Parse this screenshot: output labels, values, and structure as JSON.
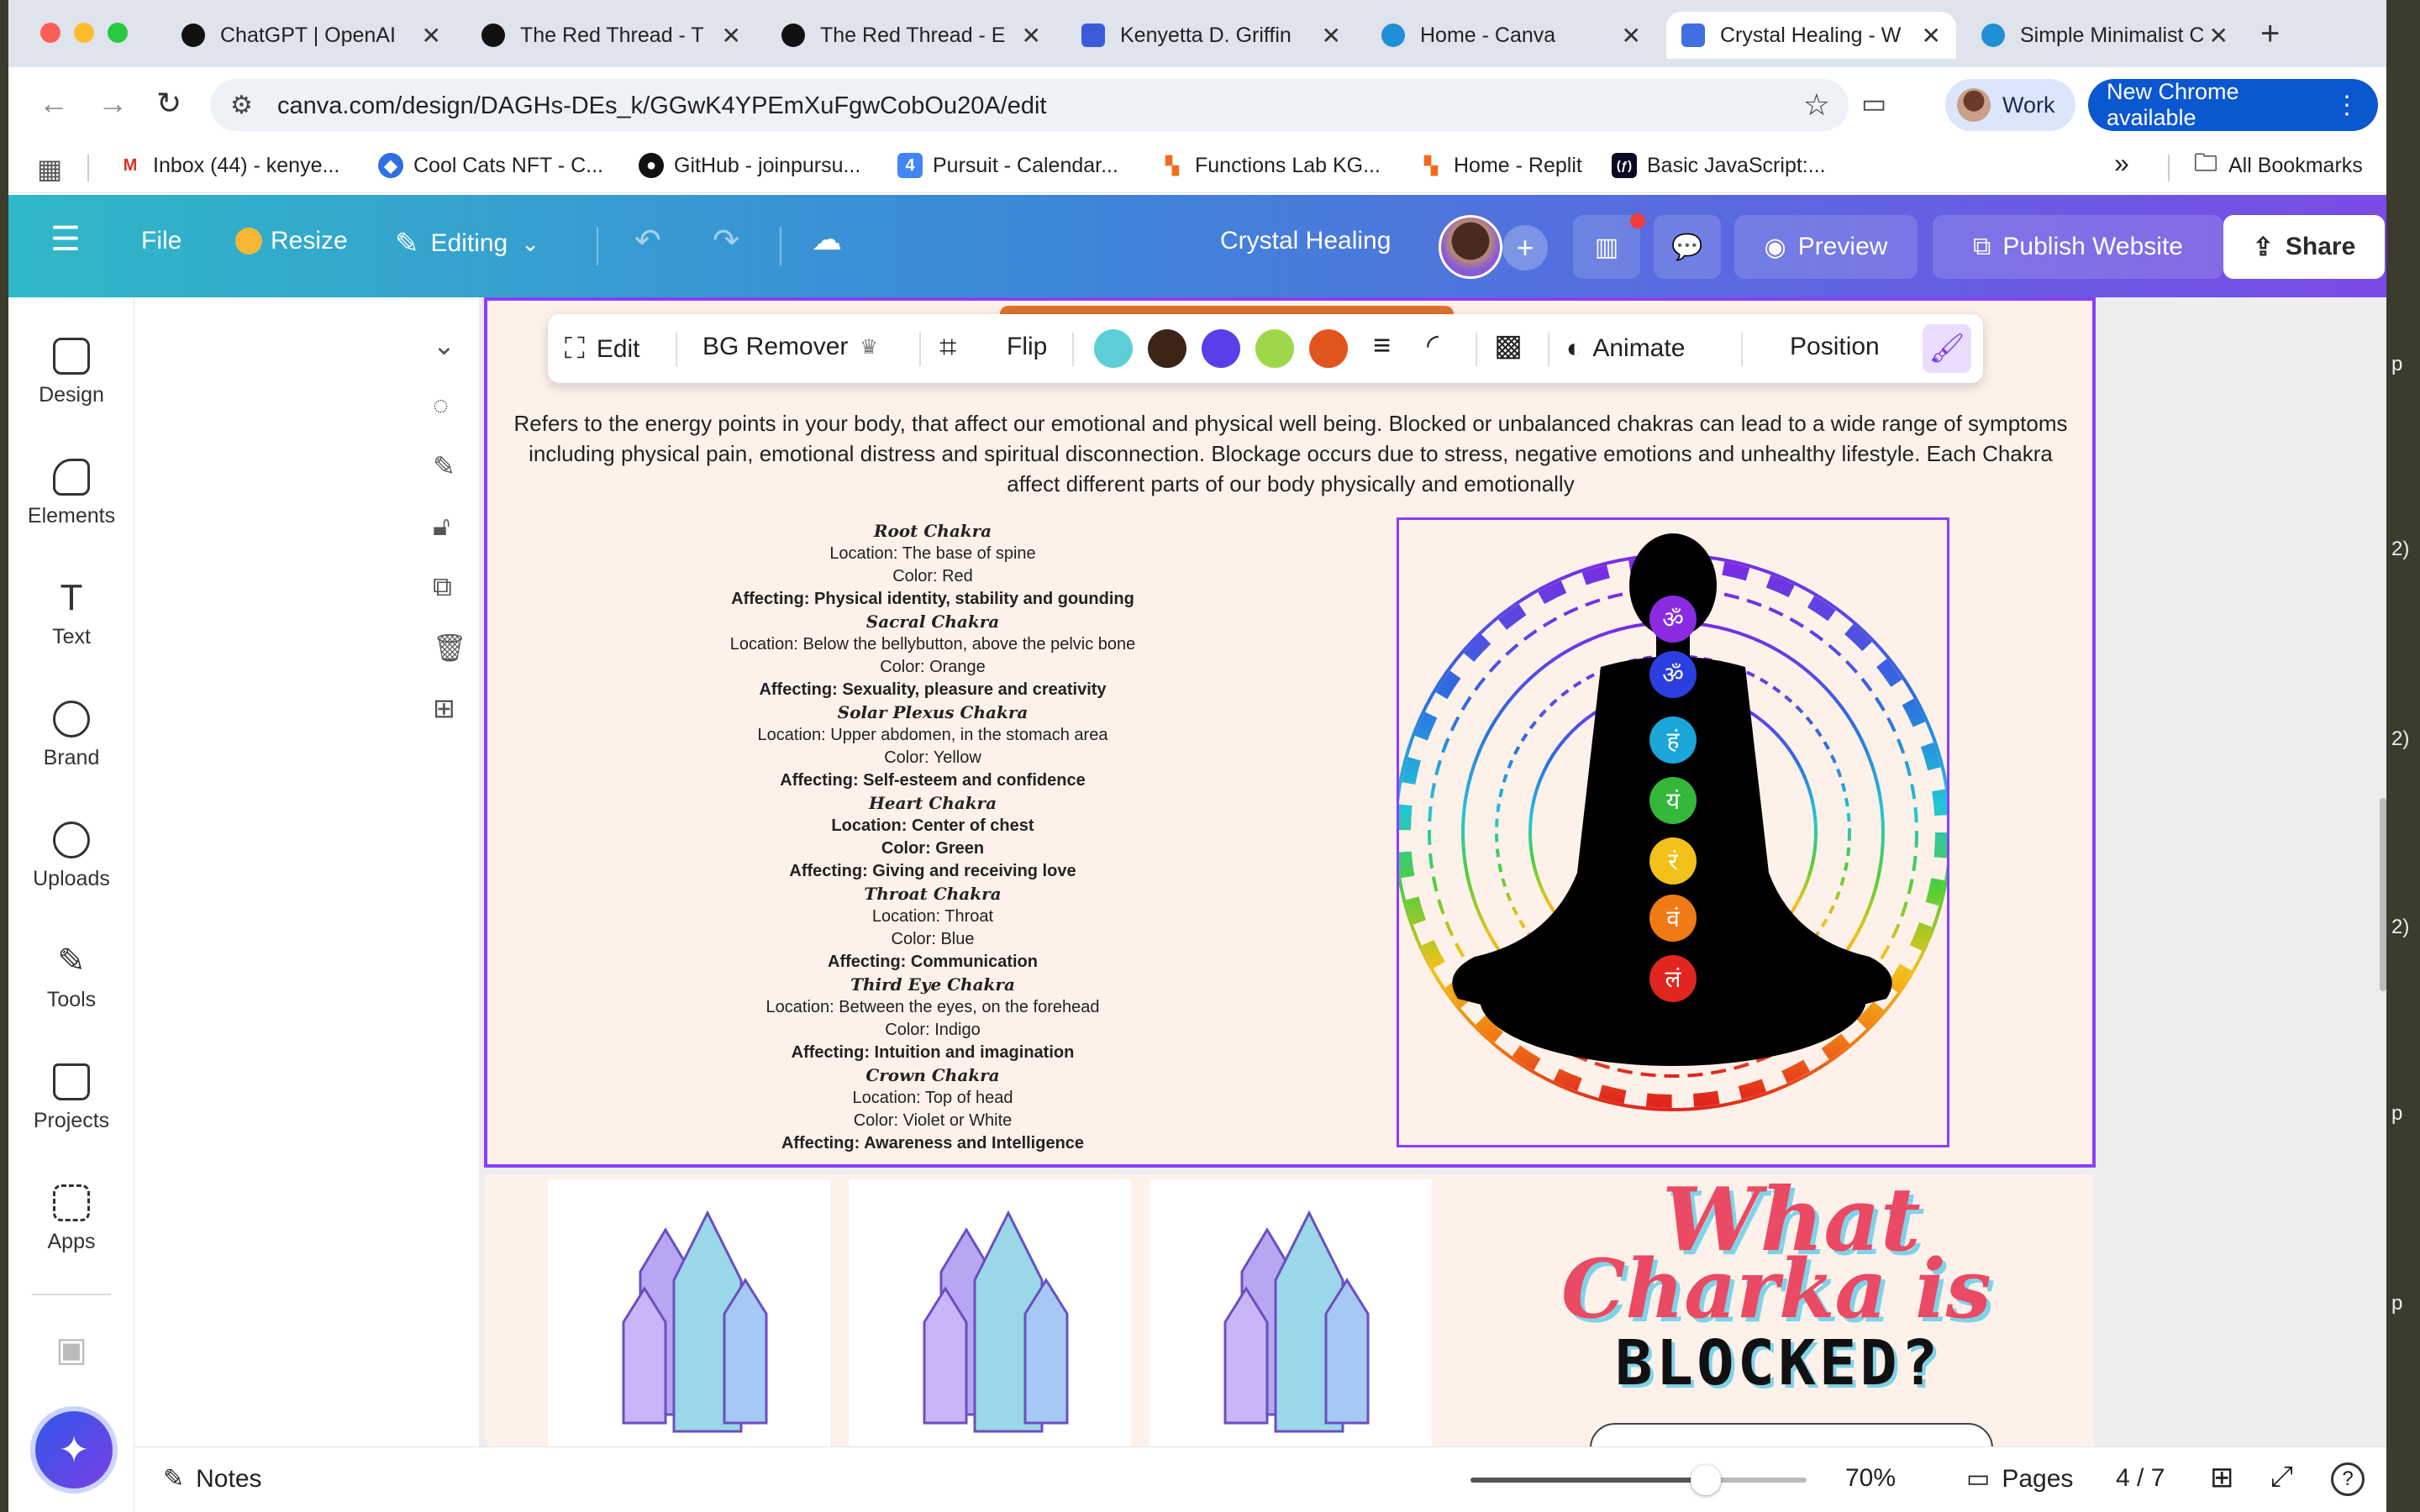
{
  "browser": {
    "tabs": [
      {
        "title": "ChatGPT | OpenAI",
        "favicon_color": "#111111"
      },
      {
        "title": "The Red Thread - T",
        "favicon_color": "#111111"
      },
      {
        "title": "The Red Thread - E",
        "favicon_color": "#111111"
      },
      {
        "title": "Kenyetta D. Griffin",
        "favicon_color": "#3b5bd9"
      },
      {
        "title": "Home - Canva",
        "favicon_color": "#1f8fd6"
      },
      {
        "title": "Crystal Healing - W",
        "favicon_color": "#3f6fe0",
        "active": true
      },
      {
        "title": "Simple Minimalist C",
        "favicon_color": "#1f8fd6"
      }
    ],
    "close_glyph": "✕",
    "new_tab_glyph": "+",
    "url": "canva.com/design/DAGHs-DEs_k/GGwK4YPEmXuFgwCobOu20A/edit",
    "profile_label": "Work",
    "update_label": "New Chrome available",
    "bookmarks": [
      {
        "label": "Inbox (44) - kenye...",
        "icon_color": "#d93025",
        "glyph": "M"
      },
      {
        "label": "Cool Cats NFT - C...",
        "icon_color": "#2f6fe4",
        "glyph": "◆"
      },
      {
        "label": "GitHub - joinpursu...",
        "icon_color": "#111111",
        "glyph": "●"
      },
      {
        "label": "Pursuit - Calendar...",
        "icon_color": "#4285f4",
        "glyph": "4"
      },
      {
        "label": "Functions Lab KG...",
        "icon_color": "#f26b1d",
        "glyph": "▚"
      },
      {
        "label": "Home - Replit",
        "icon_color": "#f26b1d",
        "glyph": "▚"
      },
      {
        "label": "Basic JavaScript:...",
        "icon_color": "#0a0a23",
        "glyph": "(ƒ)"
      }
    ],
    "bookmarks_overflow": "»",
    "all_bookmarks": "All Bookmarks"
  },
  "canva_bar": {
    "file": "File",
    "resize": "Resize",
    "editing": "Editing",
    "doc_title": "Crystal Healing",
    "preview": "Preview",
    "publish": "Publish Website",
    "share": "Share"
  },
  "rail": [
    {
      "label": "Design",
      "icon": "design-icon"
    },
    {
      "label": "Elements",
      "icon": "elements-icon"
    },
    {
      "label": "Text",
      "icon": "text-icon"
    },
    {
      "label": "Brand",
      "icon": "brand-icon"
    },
    {
      "label": "Uploads",
      "icon": "uploads-icon"
    },
    {
      "label": "Tools",
      "icon": "tools-icon"
    },
    {
      "label": "Projects",
      "icon": "projects-icon"
    },
    {
      "label": "Apps",
      "icon": "apps-icon"
    }
  ],
  "float_toolbar": {
    "edit": "Edit",
    "bg_remover": "BG Remover",
    "flip": "Flip",
    "animate": "Animate",
    "position": "Position",
    "swatches": [
      "#5ccfd6",
      "#3b2518",
      "#5b3ee8",
      "#9ed84a",
      "#e2541e"
    ]
  },
  "page": {
    "intro": "Refers to the energy points in your body, that affect our emotional and physical well being. Blocked or unbalanced chakras can lead to a wide range of symptoms including physical pain, emotional distress and spiritual disconnection. Blockage occurs due to stress, negative emotions and unhealthy lifestyle. Each Chakra affect different parts of our body physically and emotionally",
    "chakras": [
      {
        "name": "Root Chakra",
        "location": "Location: The base of spine",
        "color": "Color: Red",
        "affecting": "Affecting: Physical identity, stability and gounding",
        "bold_all": false
      },
      {
        "name": "Sacral Chakra",
        "location": "Location: Below the bellybutton, above the pelvic bone",
        "color": "Color: Orange",
        "affecting": "Affecting: Sexuality, pleasure and creativity",
        "bold_all": false
      },
      {
        "name": "Solar Plexus Chakra",
        "location": "Location: Upper abdomen, in the stomach area",
        "color": "Color: Yellow",
        "affecting": "Affecting: Self-esteem and confidence",
        "bold_all": false
      },
      {
        "name": "Heart Chakra",
        "location": "Location: Center of chest",
        "color": "Color: Green",
        "affecting": "Affecting: Giving and receiving love",
        "bold_all": true
      },
      {
        "name": "Throat Chakra",
        "location": "Location: Throat",
        "color": "Color: Blue",
        "affecting": "Affecting: Communication",
        "bold_all": false
      },
      {
        "name": "Third Eye Chakra",
        "location": "Location: Between the eyes, on the forehead",
        "color": "Color: Indigo",
        "affecting": "Affecting: Intuition and imagination",
        "bold_all": false
      },
      {
        "name": "Crown Chakra",
        "location": "Location: Top of head",
        "color": "Color: Violet or White",
        "affecting": "Affecting: Awareness and Intelligence",
        "bold_all": false
      }
    ],
    "chakra_dots": [
      "#8a2be2",
      "#2b3fe0",
      "#1aa7d8",
      "#33b83a",
      "#f2c21a",
      "#f07a14",
      "#e0261e"
    ],
    "chakra_glyphs": [
      "ॐ",
      "ॐ",
      "हं",
      "यं",
      "रं",
      "वं",
      "लं"
    ]
  },
  "page2": {
    "title_line1": "What",
    "title_line2": "Charka is",
    "title_line3": "BLOCKED?"
  },
  "bottom_bar": {
    "notes": "Notes",
    "zoom": "70%",
    "zoom_value": 0.7,
    "pages": "Pages",
    "page_count": "4 / 7",
    "help": "?"
  }
}
